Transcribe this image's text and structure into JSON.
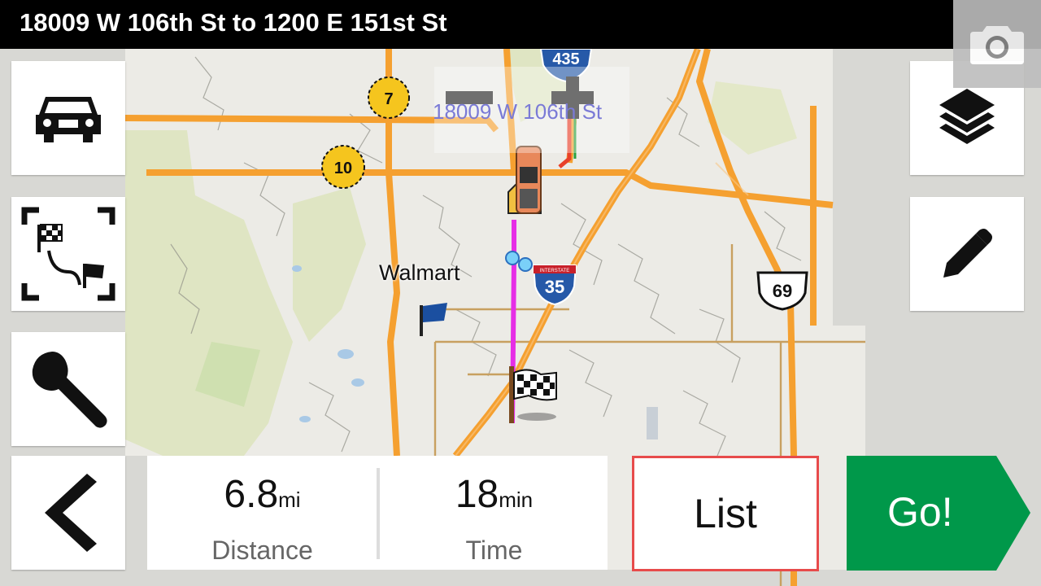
{
  "header": {
    "title": "18009 W 106th St to 1200 E 151st St"
  },
  "map": {
    "start_label": "18009 W 106th St",
    "poi_label": "Walmart",
    "shields": {
      "i435": "435",
      "i35": "35",
      "i35_top": "INTERSTATE",
      "us69": "69",
      "hwy7": "7",
      "hwy10": "10"
    }
  },
  "route": {
    "distance_value": "6.8",
    "distance_unit": "mi",
    "distance_label": "Distance",
    "time_value": "18",
    "time_unit": "min",
    "time_label": "Time"
  },
  "buttons": {
    "list_label": "List",
    "go_label": "Go!"
  },
  "colors": {
    "go_green": "#00984a",
    "list_border": "#e74b4b",
    "road": "#f5a030",
    "route": "#e62ee6"
  },
  "icons": [
    "camera-icon",
    "vehicle-icon",
    "route-overview-icon",
    "wrench-icon",
    "back-arrow-icon",
    "layers-icon",
    "pencil-icon",
    "zoom-out-icon",
    "zoom-in-icon",
    "vehicle-marker-icon",
    "finish-flag-icon",
    "waypoint-flag-icon"
  ]
}
